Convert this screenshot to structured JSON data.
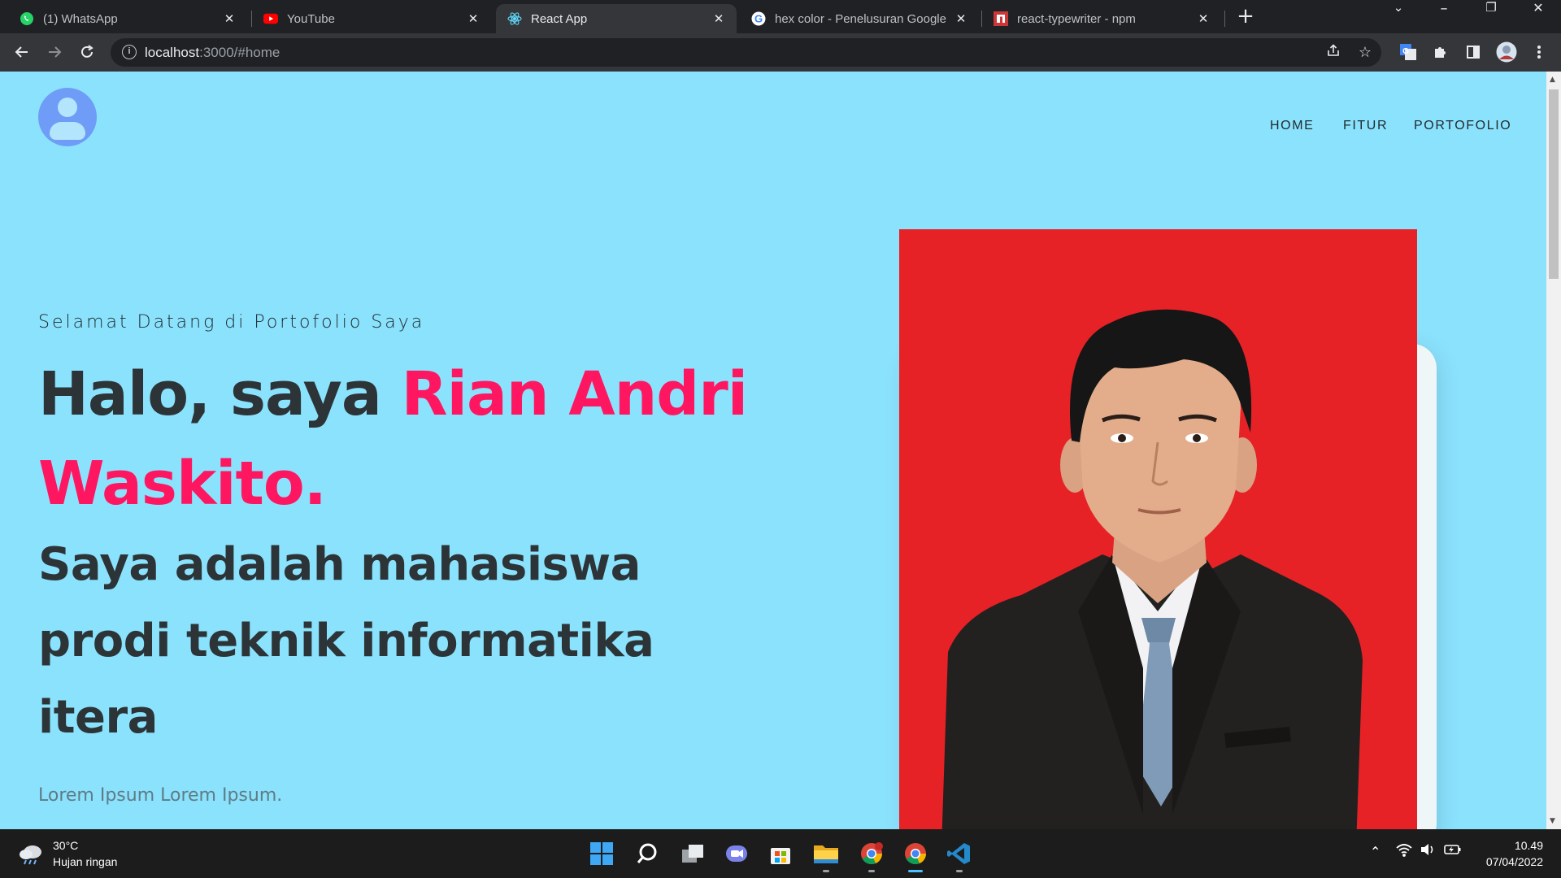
{
  "browser": {
    "tabs": [
      {
        "title": "(1) WhatsApp",
        "icon": "whatsapp-icon"
      },
      {
        "title": "YouTube",
        "icon": "youtube-icon"
      },
      {
        "title": "React App",
        "icon": "react-icon",
        "active": true
      },
      {
        "title": "hex color - Penelusuran Google",
        "icon": "google-icon"
      },
      {
        "title": "react-typewriter - npm",
        "icon": "npm-icon"
      }
    ],
    "close_glyph": "✕",
    "new_tab_glyph": "+",
    "url_host": "localhost",
    "url_rest": ":3000/#home"
  },
  "page": {
    "nav": [
      "HOME",
      "FITUR",
      "PORTOFOLIO"
    ],
    "welcome": "Selamat Datang di Portofolio Saya",
    "greeting": "Halo, saya ",
    "name": "Rian Andri Waskito.",
    "tagline": "Saya adalah mahasiswa prodi teknik informatika itera",
    "lorem": "Lorem Ipsum Lorem Ipsum.",
    "colors": {
      "background": "#8be2fd",
      "accent": "#ff1660",
      "text": "#2c3437",
      "photo_background": "#e62227"
    }
  },
  "taskbar": {
    "weather_temp": "30°C",
    "weather_desc": "Hujan ringan",
    "time": "10.49",
    "date": "07/04/2022"
  }
}
